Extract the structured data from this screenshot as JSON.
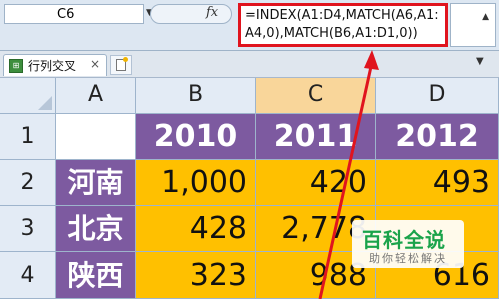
{
  "formula_bar": {
    "name_box": "C6",
    "fx_label": "fx",
    "formula_line1": "=INDEX(A1:D4,MATCH(A6,A1:",
    "formula_line2": "A4,0),MATCH(B6,A1:D1,0))"
  },
  "sheet_tabs": [
    {
      "label": "行列交叉",
      "icon": "spreadsheet-icon"
    }
  ],
  "new_tab_icon": "new-sheet-icon",
  "column_headers": [
    "A",
    "B",
    "C",
    "D"
  ],
  "selected_column": "C",
  "row_headers": [
    "1",
    "2",
    "3",
    "4"
  ],
  "cells": {
    "row1": {
      "A": "",
      "B": "2010",
      "C": "2011",
      "D": "2012"
    },
    "row2": {
      "A": "河南",
      "B": "1,000",
      "C": "420",
      "D": "493"
    },
    "row3": {
      "A": "北京",
      "B": "428",
      "C": "2,778",
      "D": ""
    },
    "row4": {
      "A": "陕西",
      "B": "323",
      "C": "988",
      "D": "616"
    }
  },
  "colors": {
    "header_purple": "#7d5aa0",
    "value_orange": "#ffc000",
    "highlight_red": "#e0141e"
  },
  "watermark": {
    "title": "百科全说",
    "subtitle": "助你轻松解决"
  }
}
